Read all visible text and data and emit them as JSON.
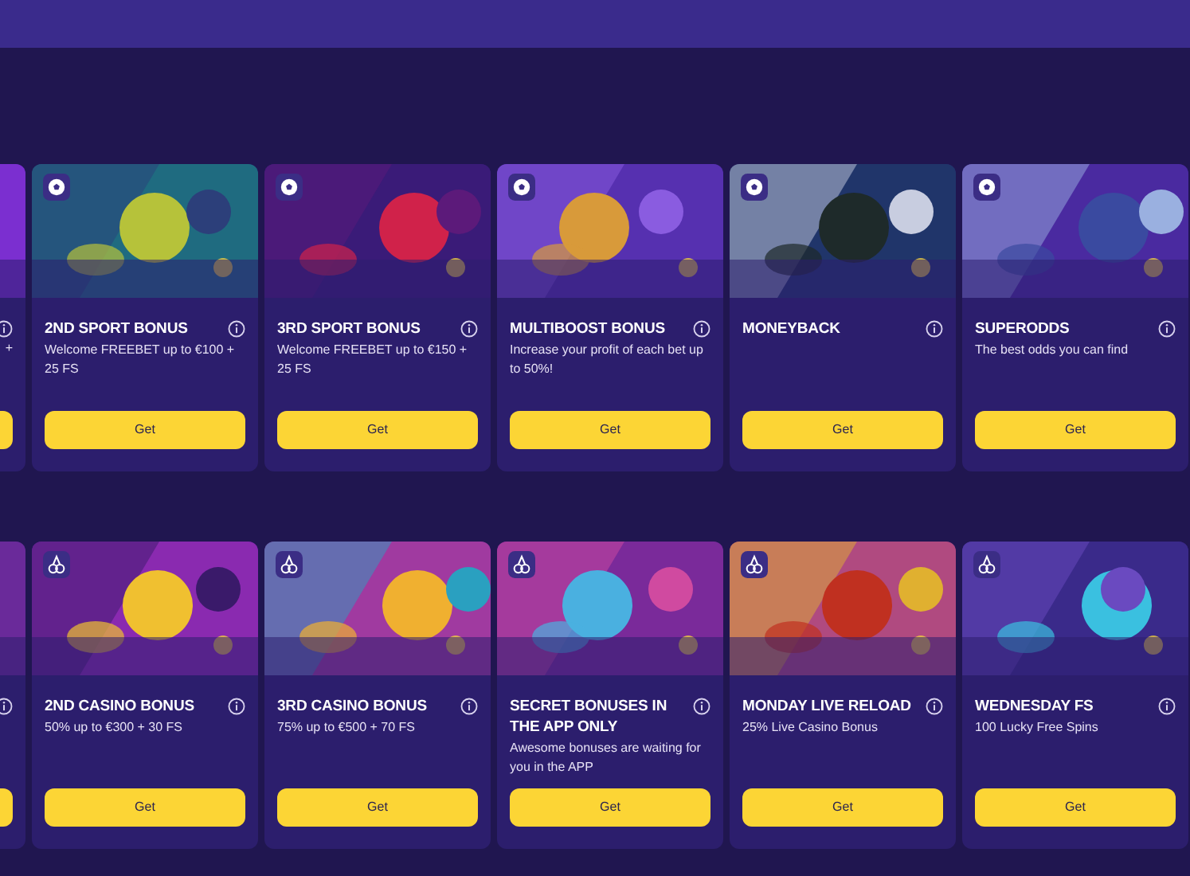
{
  "sections": [
    {
      "kind": "sport",
      "cards": [
        {
          "kind": "partial",
          "description": "+"
        },
        {
          "kind": "full",
          "title": "2ND SPORT BONUS",
          "description": "Welcome FREEBET up to €100 + 25 FS",
          "button": "Get"
        },
        {
          "kind": "full",
          "title": "3RD SPORT BONUS",
          "description": "Welcome FREEBET up to €150 + 25 FS",
          "button": "Get"
        },
        {
          "kind": "full",
          "title": "MULTIBOOST BONUS",
          "description": "Increase your profit of each bet up to 50%!",
          "button": "Get"
        },
        {
          "kind": "full",
          "title": "MONEYBACK",
          "button": "Get"
        },
        {
          "kind": "full",
          "title": "SUPERODDS",
          "description": "The best odds you can find",
          "button": "Get"
        }
      ]
    },
    {
      "kind": "casino",
      "cards": [
        {
          "kind": "partial"
        },
        {
          "kind": "full",
          "title": "2ND CASINO BONUS",
          "description": "50% up to €300 + 30 FS",
          "button": "Get"
        },
        {
          "kind": "full",
          "title": "3RD CASINO BONUS",
          "description": "75% up to €500 + 70 FS",
          "button": "Get"
        },
        {
          "kind": "full",
          "title": "SECRET BONUSES IN THE APP ONLY",
          "description": "Awesome bonuses are waiting for you in the APP",
          "button": "Get"
        },
        {
          "kind": "full",
          "title": "MONDAY LIVE RELOAD",
          "description": "25% Live Casino Bonus",
          "button": "Get"
        },
        {
          "kind": "full",
          "title": "WEDNESDAY FS",
          "description": "100 Lucky Free Spins",
          "button": "Get"
        }
      ]
    }
  ]
}
